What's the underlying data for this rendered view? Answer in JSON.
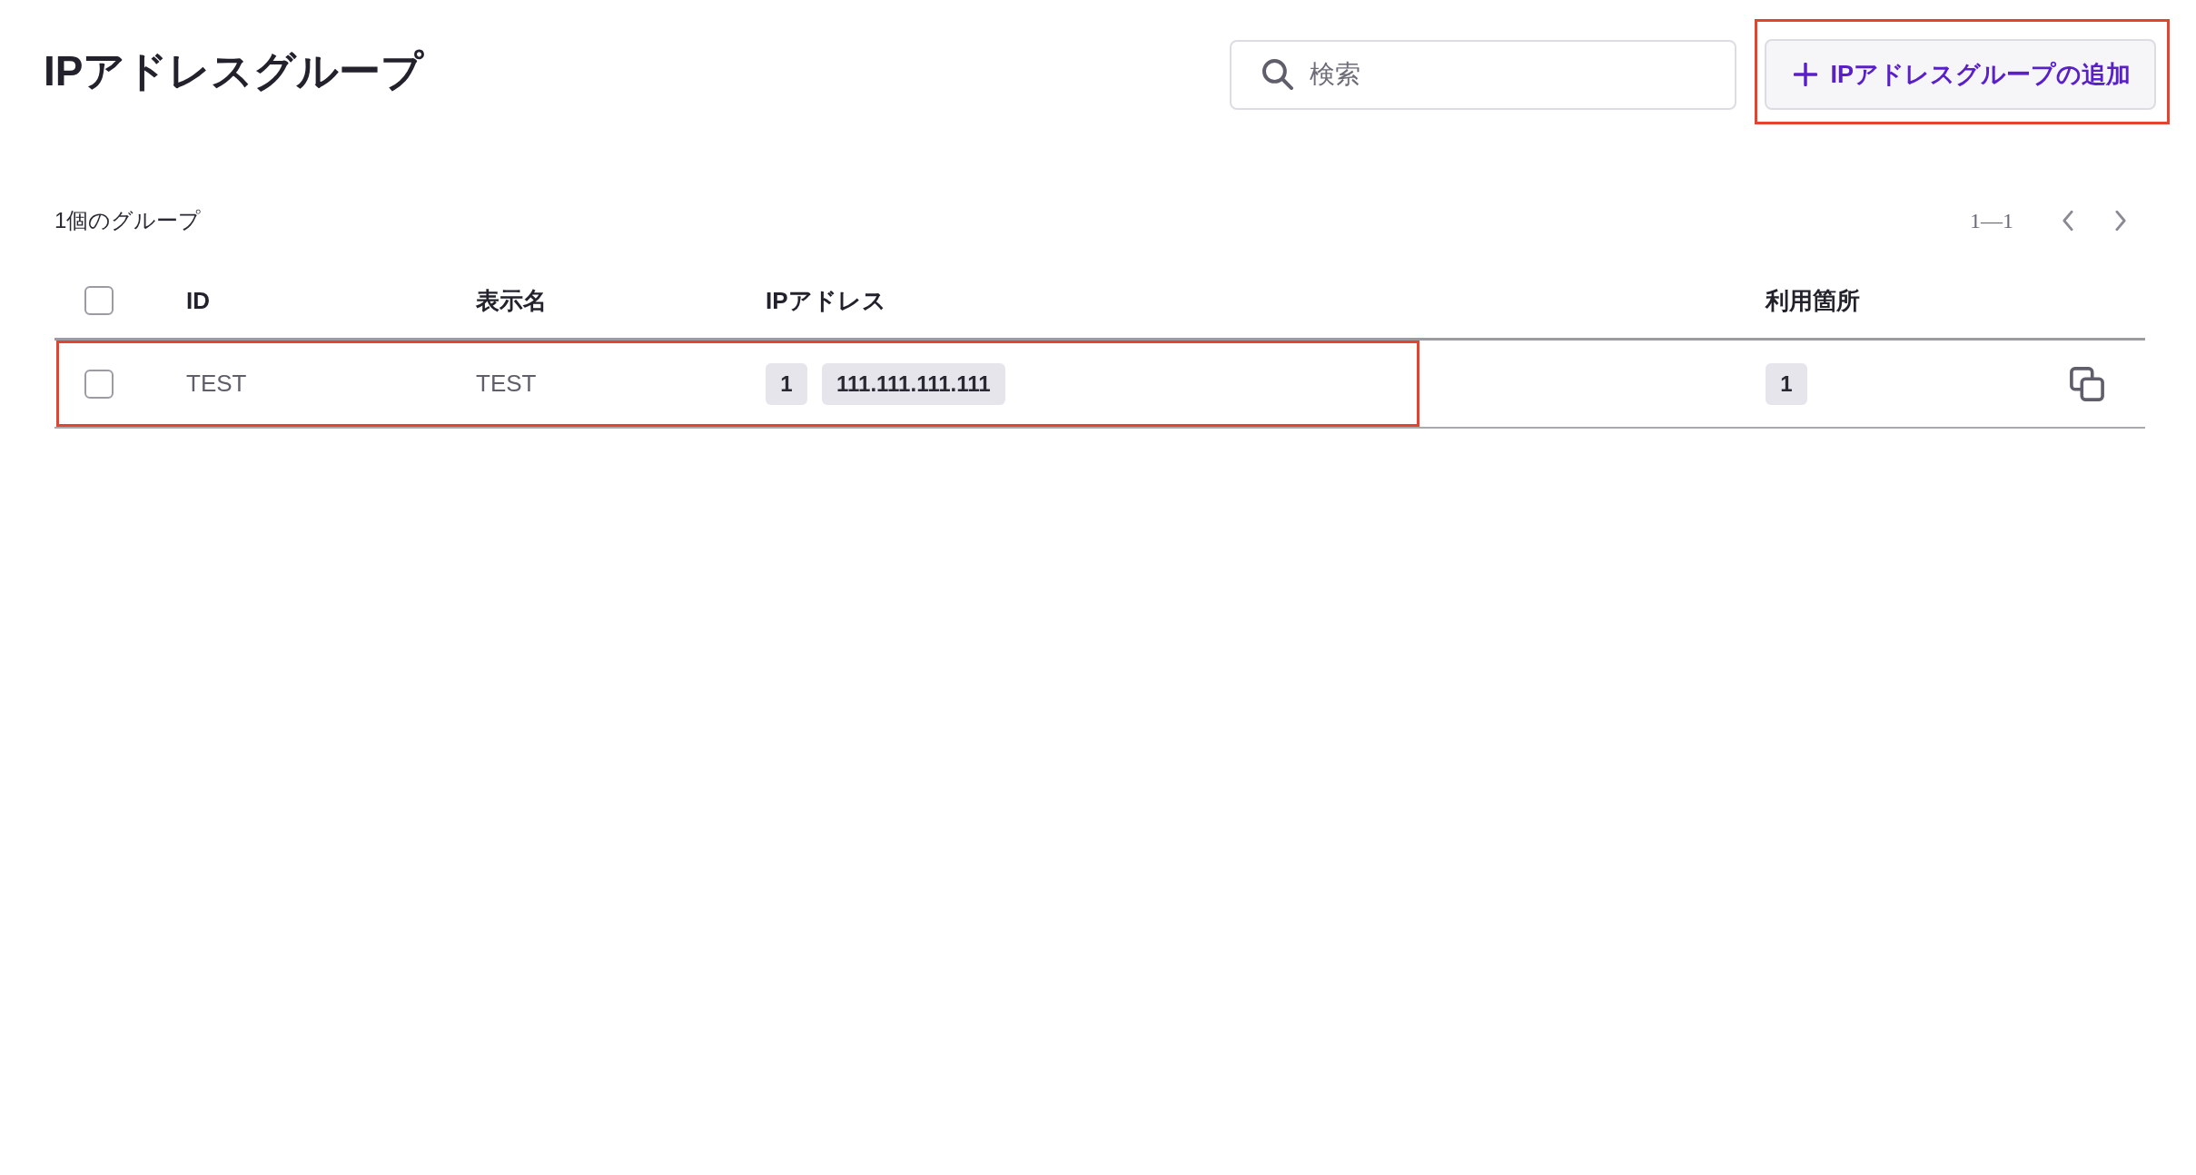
{
  "header": {
    "title": "IPアドレスグループ",
    "search": {
      "placeholder": "検索"
    },
    "add_button": {
      "label": "IPアドレスグループの追加",
      "highlighted": true
    }
  },
  "summary": {
    "count": "1個のグループ",
    "range": "1—1"
  },
  "table": {
    "select_all": {
      "checked": false
    },
    "columns": [
      "ID",
      "表示名",
      "IPアドレス",
      "利用箇所"
    ],
    "rows": [
      {
        "checked": false,
        "highlighted": true,
        "id": "TEST",
        "display_name": "TEST",
        "ip_count": "1",
        "ip_addresses": [
          "111.111.111.111"
        ],
        "usage_count": "1"
      }
    ]
  }
}
